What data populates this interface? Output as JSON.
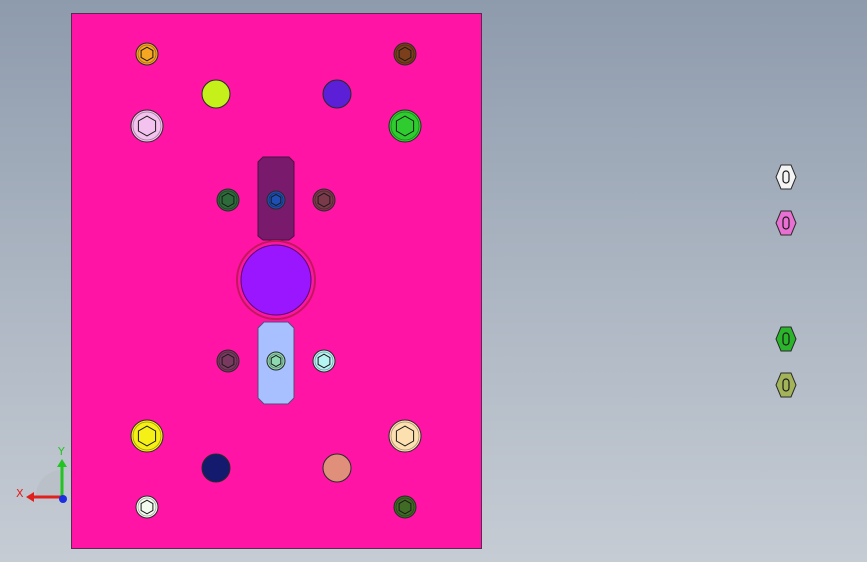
{
  "colors": {
    "plate": "#ff14a6",
    "plate_outline": "#5a2a50",
    "slot_top": "#7a1a6c",
    "slot_bottom": "#a8c0ff",
    "center_hole": "#9a16ff",
    "center_ring": "#c2185b"
  },
  "bolts": [
    {
      "name": "bolt-orange",
      "color": "#f5a623",
      "style": "hex"
    },
    {
      "name": "bolt-brown",
      "color": "#7b3f1c",
      "style": "hex"
    },
    {
      "name": "bolt-lime",
      "color": "#c6f01a",
      "style": "plain"
    },
    {
      "name": "bolt-violet",
      "color": "#5a1fd6",
      "style": "plain"
    },
    {
      "name": "bolt-pink-light",
      "color": "#f4c2ee",
      "style": "hex"
    },
    {
      "name": "bolt-green",
      "color": "#2ecc2e",
      "style": "hex"
    },
    {
      "name": "bolt-darkgreen-left",
      "color": "#2e6b3a",
      "style": "hex"
    },
    {
      "name": "bolt-blue-center",
      "color": "#1e4fb4",
      "style": "hex"
    },
    {
      "name": "bolt-mauve",
      "color": "#7a3a4a",
      "style": "hex"
    },
    {
      "name": "bolt-plum",
      "color": "#7a3a60",
      "style": "hex"
    },
    {
      "name": "bolt-mint-center",
      "color": "#8fd9b0",
      "style": "hex"
    },
    {
      "name": "bolt-cyan",
      "color": "#b6f4f4",
      "style": "hex"
    },
    {
      "name": "bolt-yellow",
      "color": "#f5f016",
      "style": "hex"
    },
    {
      "name": "bolt-cream",
      "color": "#fce0b0",
      "style": "hex"
    },
    {
      "name": "bolt-navy",
      "color": "#141a6e",
      "style": "plain"
    },
    {
      "name": "bolt-salmon",
      "color": "#e0907a",
      "style": "plain"
    },
    {
      "name": "bolt-white",
      "color": "#f4fbef",
      "style": "hex"
    },
    {
      "name": "bolt-olive-dark",
      "color": "#3f6b24",
      "style": "hex"
    }
  ],
  "side_parts": [
    {
      "name": "side-part-white",
      "color": "#f4f4f4"
    },
    {
      "name": "side-part-pink",
      "color": "#e870d2"
    },
    {
      "name": "side-part-green",
      "color": "#2bb52b"
    },
    {
      "name": "side-part-olive",
      "color": "#a3b35a"
    }
  ],
  "triad": {
    "x_label": "X",
    "y_label": "Y",
    "x_color": "#e0201c",
    "y_color": "#22c422",
    "z_color": "#1c2fe0"
  }
}
